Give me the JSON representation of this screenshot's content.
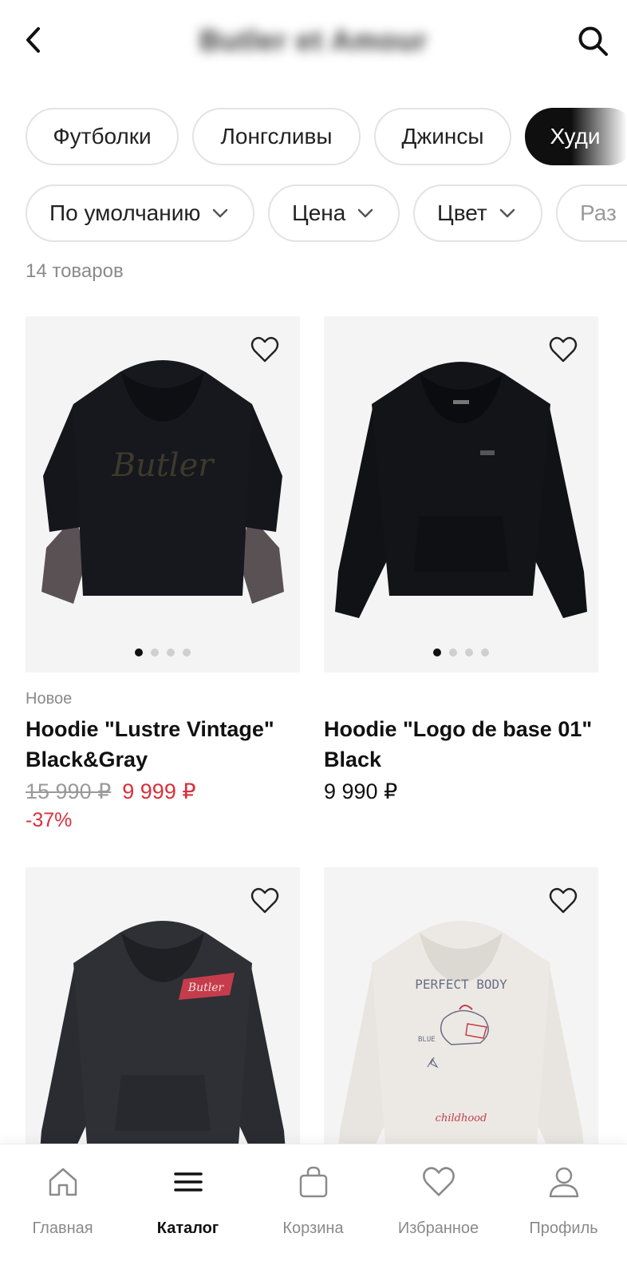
{
  "header": {
    "title": "Butler et Amour",
    "back_icon": "chevron-left-icon",
    "search_icon": "search-icon"
  },
  "categories": [
    {
      "label": "Футболки",
      "active": false
    },
    {
      "label": "Лонгсливы",
      "active": false
    },
    {
      "label": "Джинсы",
      "active": false
    },
    {
      "label": "Худи",
      "active": true
    }
  ],
  "filters": [
    {
      "label": "По умолчанию"
    },
    {
      "label": "Цена"
    },
    {
      "label": "Цвет"
    },
    {
      "label": "Раз"
    }
  ],
  "product_count": "14 товаров",
  "products": [
    {
      "badge": "Новое",
      "name": "Hoodie \"Lustre Vintage\" Black&Gray",
      "old_price": "15 990 ₽",
      "price": "9 999 ₽",
      "discount": "-37%",
      "image_dots": 4,
      "active_dot": 0
    },
    {
      "badge": "",
      "name": "Hoodie \"Logo de base 01\" Black",
      "price": "9 990 ₽",
      "image_dots": 4,
      "active_dot": 0
    },
    {
      "badge": "",
      "name": "",
      "price": ""
    },
    {
      "badge": "",
      "name": "",
      "price": ""
    }
  ],
  "nav": [
    {
      "label": "Главная",
      "icon": "home-icon",
      "active": false
    },
    {
      "label": "Каталог",
      "icon": "menu-icon",
      "active": true
    },
    {
      "label": "Корзина",
      "icon": "bag-icon",
      "active": false
    },
    {
      "label": "Избранное",
      "icon": "heart-icon",
      "active": false
    },
    {
      "label": "Профиль",
      "icon": "profile-icon",
      "active": false
    }
  ],
  "colors": {
    "sale": "#d9303b",
    "active_chip": "#0f0f0f",
    "muted": "#8a8a8a"
  }
}
